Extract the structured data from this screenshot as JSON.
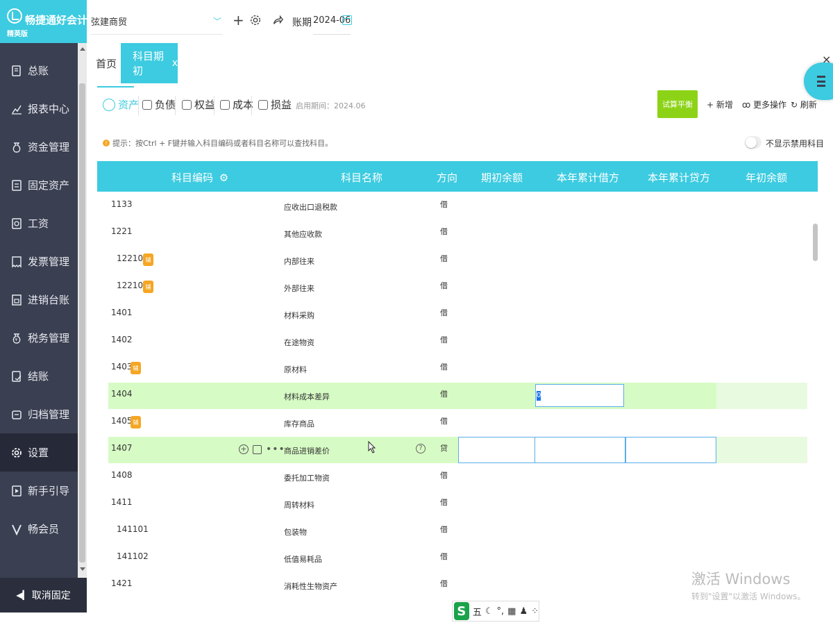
{
  "app": {
    "name": "畅捷通好会计",
    "edition": "精英版"
  },
  "sidebar": {
    "items": [
      {
        "label": "总账",
        "icon": "ledger-icon"
      },
      {
        "label": "报表中心",
        "icon": "chart-icon"
      },
      {
        "label": "资金管理",
        "icon": "money-bag-icon"
      },
      {
        "label": "固定资产",
        "icon": "document-icon"
      },
      {
        "label": "工资",
        "icon": "salary-icon"
      },
      {
        "label": "发票管理",
        "icon": "invoice-icon"
      },
      {
        "label": "进销台账",
        "icon": "inventory-icon"
      },
      {
        "label": "税务管理",
        "icon": "tax-icon"
      },
      {
        "label": "结账",
        "icon": "closing-icon"
      },
      {
        "label": "归档管理",
        "icon": "archive-icon"
      },
      {
        "label": "设置",
        "icon": "gear-icon",
        "active": true
      },
      {
        "label": "新手引导",
        "icon": "play-icon"
      },
      {
        "label": "畅会员",
        "icon": "vip-icon"
      }
    ],
    "unpin_label": "取消固定"
  },
  "topbar": {
    "company": "弦建商贸",
    "period_label": "账期",
    "period_value": "2024-06"
  },
  "tabs": [
    {
      "label": "首页",
      "active": false
    },
    {
      "label": "科目期初",
      "close": "x",
      "active": true
    }
  ],
  "categories": [
    {
      "label": "资产",
      "active": true
    },
    {
      "label": "负债",
      "active": false
    },
    {
      "label": "权益",
      "active": false
    },
    {
      "label": "成本",
      "active": false
    },
    {
      "label": "损益",
      "active": false
    }
  ],
  "start_period": "启用期间：2024.06",
  "actions": {
    "trial_balance": "试算平衡",
    "add": "+ 新增",
    "more": "更多操作",
    "refresh": "刷新"
  },
  "hint": "提示：按Ctrl + F键并输入科目编码或者科目名称可以查找科目。",
  "toggle_label": "不显示禁用科目",
  "table": {
    "headers": [
      "科目编码",
      "科目名称",
      "方向",
      "期初余额",
      "本年累计借方",
      "本年累计贷方",
      "年初余额"
    ],
    "rows": [
      {
        "code": "1133",
        "name": "应收出口退税款",
        "dir": "借",
        "indent": false,
        "badge": false
      },
      {
        "code": "1221",
        "name": "其他应收款",
        "dir": "借",
        "indent": false,
        "badge": false
      },
      {
        "code": "122101",
        "name": "内部往来",
        "dir": "借",
        "indent": true,
        "badge": true
      },
      {
        "code": "122102",
        "name": "外部往来",
        "dir": "借",
        "indent": true,
        "badge": true
      },
      {
        "code": "1401",
        "name": "材料采购",
        "dir": "借",
        "indent": false,
        "badge": false
      },
      {
        "code": "1402",
        "name": "在途物资",
        "dir": "借",
        "indent": false,
        "badge": false
      },
      {
        "code": "1403",
        "name": "原材料",
        "dir": "借",
        "indent": false,
        "badge": true
      },
      {
        "code": "1404",
        "name": "材料成本差异",
        "dir": "借",
        "indent": false,
        "badge": false,
        "highlight": true,
        "value": "0"
      },
      {
        "code": "1405",
        "name": "库存商品",
        "dir": "借",
        "indent": false,
        "badge": true
      },
      {
        "code": "1407",
        "name": "商品进销差价",
        "dir": "贷",
        "indent": false,
        "badge": false,
        "highlight": true,
        "hover": true
      },
      {
        "code": "1408",
        "name": "委托加工物资",
        "dir": "借",
        "indent": false,
        "badge": false
      },
      {
        "code": "1411",
        "name": "周转材料",
        "dir": "借",
        "indent": false,
        "badge": false
      },
      {
        "code": "141101",
        "name": "包装物",
        "dir": "借",
        "indent": true,
        "badge": false
      },
      {
        "code": "141102",
        "name": "低值易耗品",
        "dir": "借",
        "indent": true,
        "badge": false
      },
      {
        "code": "1421",
        "name": "消耗性生物资产",
        "dir": "借",
        "indent": false,
        "badge": false
      }
    ],
    "badge_text": "辅"
  },
  "watermark": {
    "line1": "激活 Windows",
    "line2": "转到\"设置\"以激活 Windows。"
  },
  "ime": {
    "logo": "S",
    "mode": "五",
    "symbols": "°,"
  },
  "colors": {
    "accent": "#3ccbe0",
    "sidebar": "#3a3f51",
    "trial_button": "#8cd317",
    "badge": "#f5a623",
    "row_highlight": "#d7fbc5"
  }
}
